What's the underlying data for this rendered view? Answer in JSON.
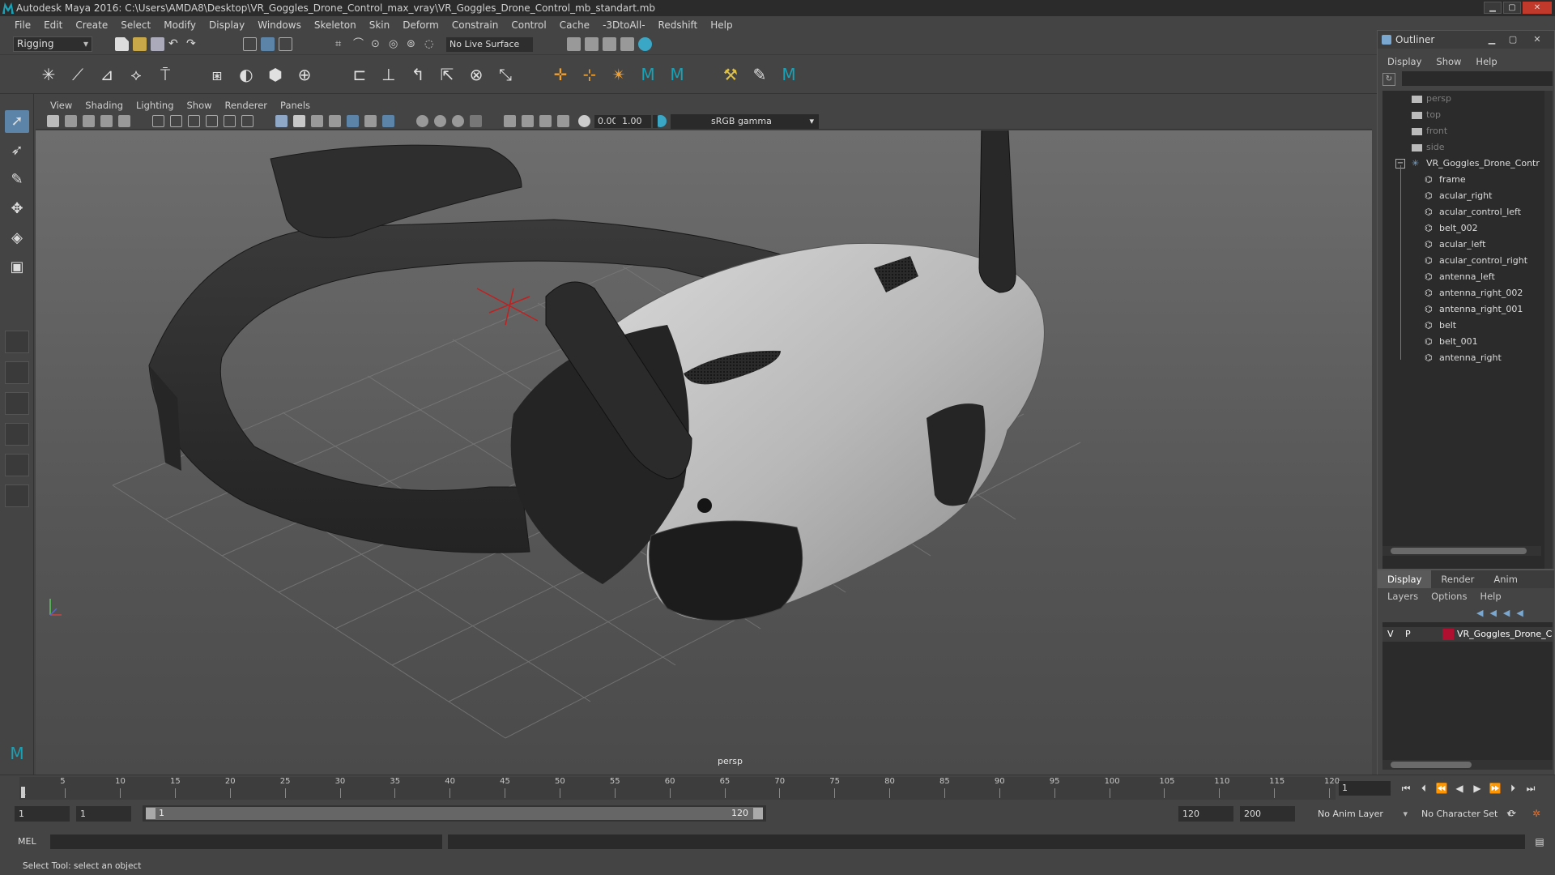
{
  "window": {
    "title": "Autodesk Maya 2016: C:\\Users\\AMDA8\\Desktop\\VR_Goggles_Drone_Control_max_vray\\VR_Goggles_Drone_Control_mb_standart.mb",
    "minimize": "▁",
    "maximize": "▢",
    "close": "✕"
  },
  "menubar": [
    "File",
    "Edit",
    "Create",
    "Select",
    "Modify",
    "Display",
    "Windows",
    "Skeleton",
    "Skin",
    "Deform",
    "Constrain",
    "Control",
    "Cache",
    "-3DtoAll-",
    "Redshift",
    "Help"
  ],
  "shelf": {
    "mode": "Rigging",
    "live_surface": "No Live Surface"
  },
  "viewport": {
    "menu": [
      "View",
      "Shading",
      "Lighting",
      "Show",
      "Renderer",
      "Panels"
    ],
    "exposure": "0.00",
    "gamma": "1.00",
    "color_space": "sRGB gamma",
    "camera_label": "persp"
  },
  "outliner": {
    "title": "Outliner",
    "menu": [
      "Display",
      "Show",
      "Help"
    ],
    "cameras": [
      "persp",
      "top",
      "front",
      "side"
    ],
    "group": "VR_Goggles_Drone_Contr",
    "children": [
      "frame",
      "acular_right",
      "acular_control_left",
      "belt_002",
      "acular_left",
      "acular_control_right",
      "antenna_left",
      "antenna_right_002",
      "antenna_right_001",
      "belt",
      "belt_001",
      "antenna_right"
    ]
  },
  "layers": {
    "tabs": [
      "Display",
      "Render",
      "Anim"
    ],
    "menu": [
      "Layers",
      "Options",
      "Help"
    ],
    "row": {
      "v": "V",
      "p": "P",
      "name": "VR_Goggles_Drone_Co",
      "color": "#b0102f"
    }
  },
  "timeline": {
    "ticks": [
      "5",
      "10",
      "15",
      "20",
      "25",
      "30",
      "35",
      "40",
      "45",
      "50",
      "55",
      "60",
      "65",
      "70",
      "75",
      "80",
      "85",
      "90",
      "95",
      "100",
      "105",
      "110",
      "115",
      "120"
    ],
    "start_label": "1",
    "current_frame": "1"
  },
  "range": {
    "start": "1",
    "playback_start": "1",
    "slider_start": "1",
    "slider_end": "120",
    "playback_end": "120",
    "end": "200",
    "anim_layer": "No Anim Layer",
    "character_set": "No Character Set"
  },
  "command": {
    "label": "MEL"
  },
  "help_line": "Select Tool: select an object",
  "colors": {
    "accent": "#5b84a8",
    "layer": "#b0102f"
  }
}
